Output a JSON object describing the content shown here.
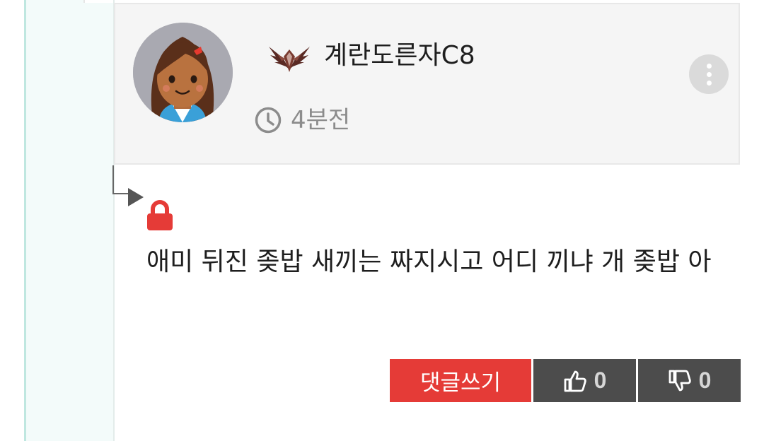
{
  "comment": {
    "author": {
      "username": "계란도른자C8",
      "avatar_icon": "girl-avatar-icon",
      "badge_icon": "winged-rank-badge-icon"
    },
    "posted_ago": "4분전",
    "locked": true,
    "body": "애미 뒤진 좆밥 새끼는 짜지시고 어디 끼냐 개 좆밥 아"
  },
  "actions": {
    "reply_label": "댓글쓰기",
    "like_count": "0",
    "dislike_count": "0"
  },
  "colors": {
    "reply_button": "#e53b37",
    "vote_button": "#4c4c4c",
    "header_bg": "#f5f5f5",
    "indent_bg": "#f3fbfa",
    "rail": "#bfe7e0"
  }
}
